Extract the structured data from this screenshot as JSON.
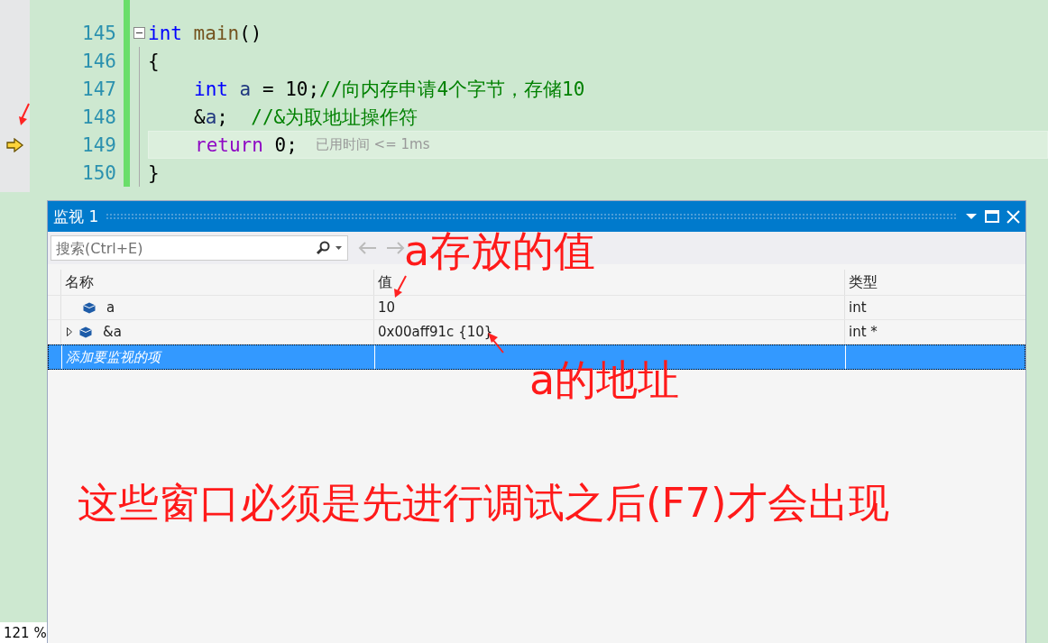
{
  "editor": {
    "lines": [
      {
        "number": "145",
        "current": false,
        "fold": true,
        "indented": false,
        "tokens": [
          {
            "kind": "keyword",
            "text": "int"
          },
          {
            "kind": "func",
            "text": " main"
          },
          {
            "kind": "plain",
            "text": "()"
          }
        ]
      },
      {
        "number": "146",
        "current": false,
        "indented": false,
        "tokens": [
          {
            "kind": "plain",
            "text": "{"
          }
        ]
      },
      {
        "number": "147",
        "current": false,
        "indented": true,
        "tokens": [
          {
            "kind": "keyword",
            "text": "int"
          },
          {
            "kind": "var",
            "text": " a"
          },
          {
            "kind": "plain",
            "text": " = 10;"
          },
          {
            "kind": "comment",
            "text": "//向内存申请4个字节，存储10"
          }
        ]
      },
      {
        "number": "148",
        "current": false,
        "indented": true,
        "tokens": [
          {
            "kind": "plain",
            "text": "&"
          },
          {
            "kind": "var",
            "text": "a"
          },
          {
            "kind": "plain",
            "text": ";"
          },
          {
            "kind": "comment",
            "text": "  //&为取地址操作符"
          }
        ]
      },
      {
        "number": "149",
        "current": true,
        "indented": true,
        "tokens": [
          {
            "kind": "control",
            "text": "return"
          },
          {
            "kind": "plain",
            "text": " 0;"
          }
        ],
        "perf_tip": "已用时间 <= 1ms"
      },
      {
        "number": "150",
        "current": false,
        "indented": false,
        "tokens": [
          {
            "kind": "plain",
            "text": "}"
          }
        ]
      }
    ]
  },
  "watch": {
    "title": "监视 1",
    "search": {
      "placeholder": "搜索(Ctrl+E)"
    },
    "columns": [
      "名称",
      "值",
      "类型"
    ],
    "rows": [
      {
        "name": "a",
        "value": "10",
        "type": "int",
        "expandable": false,
        "selected": false
      },
      {
        "name": "&a",
        "value": "0x00aff91c {10}",
        "type": "int *",
        "expandable": true,
        "selected": false
      }
    ],
    "add_row": {
      "placeholder": "添加要监视的项",
      "selected": true
    }
  },
  "annotations": [
    {
      "text": "a存放的值",
      "kind": "label1"
    },
    {
      "text": "a的地址",
      "kind": "label2"
    },
    {
      "text": "这些窗口必须是先进行调试之后(F7)才会出现",
      "kind": "note"
    }
  ],
  "zoom": "121 %"
}
